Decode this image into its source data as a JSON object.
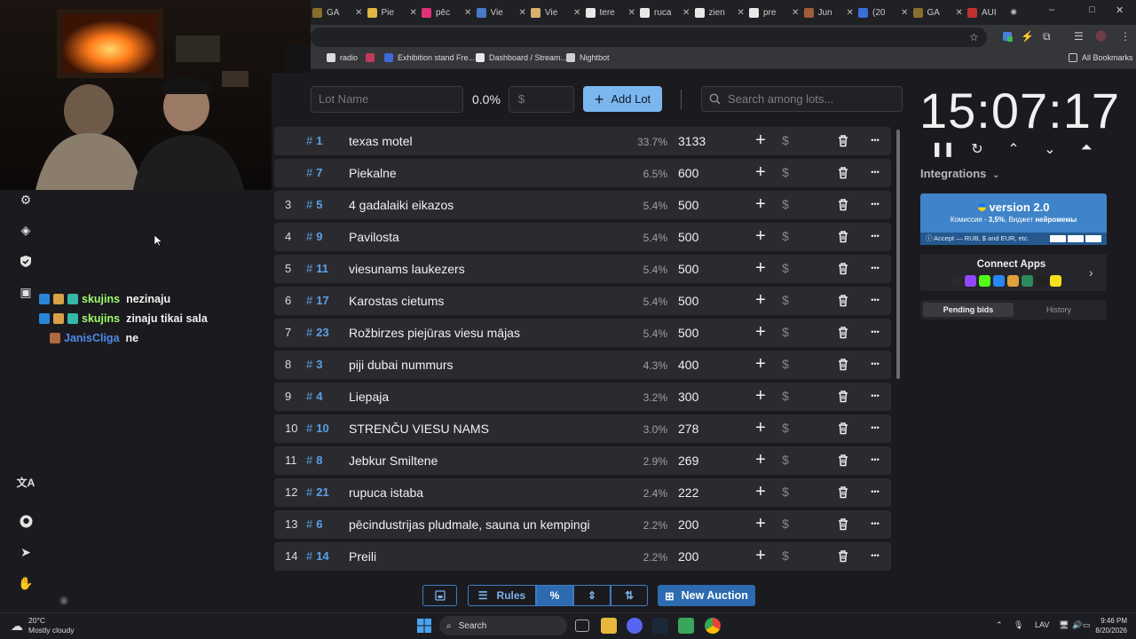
{
  "browser": {
    "tabs": [
      {
        "label": "GA",
        "color": "#8a6d2e"
      },
      {
        "label": "Pie",
        "color": "#e0b640"
      },
      {
        "label": "pēc",
        "color": "#e0307a"
      },
      {
        "label": "Vie",
        "color": "#4a78c8"
      },
      {
        "label": "Vie",
        "color": "#d8b070"
      },
      {
        "label": "tere",
        "color": "#e8e8e8"
      },
      {
        "label": "ruca",
        "color": "#e8e8e8"
      },
      {
        "label": "zien",
        "color": "#e8e8e8"
      },
      {
        "label": "pre",
        "color": "#e8e8e8"
      },
      {
        "label": "Jun",
        "color": "#a05c3a"
      },
      {
        "label": "(20",
        "color": "#3b6fd8"
      },
      {
        "label": "GA",
        "color": "#8a6d2e"
      },
      {
        "label": "AUI",
        "color": "#c03030"
      }
    ],
    "new_tab_symbol": "+",
    "window_controls": {
      "minimize": "–",
      "maximize": "□",
      "close": "✕"
    },
    "bookmarks": [
      {
        "label": "radio",
        "color": "#ddd"
      },
      {
        "label": "",
        "color": "#c23a5a"
      },
      {
        "label": "Exhibition stand Fre...",
        "color": "#3d6bd6"
      },
      {
        "label": "Dashboard / Stream...",
        "color": "#e8e8e8"
      },
      {
        "label": "Nightbot",
        "color": "#cfcfcf"
      }
    ],
    "all_bookmarks": "All Bookmarks"
  },
  "chat": [
    {
      "user": "skujins",
      "message": "nezinaju",
      "color": "#9dfc6a"
    },
    {
      "user": "skujins",
      "message": "zinaju tikai sala",
      "color": "#9dfc6a"
    },
    {
      "user": "JanisCliga",
      "message": "ne",
      "color": "#4f8ae8"
    }
  ],
  "auction": {
    "lot_name_placeholder": "Lot Name",
    "percent": "0.0%",
    "amount_placeholder": "$",
    "add_lot": "Add Lot",
    "search_placeholder": "Search among lots...",
    "lots": [
      {
        "idx": "",
        "num": "1",
        "name": "texas motel",
        "pct": "33.7%",
        "amount": "3133"
      },
      {
        "idx": "",
        "num": "7",
        "name": "Piekalne",
        "pct": "6.5%",
        "amount": "600"
      },
      {
        "idx": "3",
        "num": "5",
        "name": "4 gadalaiki eikazos",
        "pct": "5.4%",
        "amount": "500"
      },
      {
        "idx": "4",
        "num": "9",
        "name": "Pavilosta",
        "pct": "5.4%",
        "amount": "500"
      },
      {
        "idx": "5",
        "num": "11",
        "name": " viesunams laukezers",
        "pct": "5.4%",
        "amount": "500"
      },
      {
        "idx": "6",
        "num": "17",
        "name": "Karostas cietums",
        "pct": "5.4%",
        "amount": "500"
      },
      {
        "idx": "7",
        "num": "23",
        "name": "Rožbirzes piejūras viesu mājas",
        "pct": "5.4%",
        "amount": "500"
      },
      {
        "idx": "8",
        "num": "3",
        "name": "piji dubai nummurs",
        "pct": "4.3%",
        "amount": "400"
      },
      {
        "idx": "9",
        "num": "4",
        "name": "Liepaja",
        "pct": "3.2%",
        "amount": "300"
      },
      {
        "idx": "10",
        "num": "10",
        "name": "STRENČU VIESU NAMS",
        "pct": "3.0%",
        "amount": "278"
      },
      {
        "idx": "11",
        "num": "8",
        "name": "Jebkur Smiltene",
        "pct": "2.9%",
        "amount": "269"
      },
      {
        "idx": "12",
        "num": "21",
        "name": "rupuca istaba",
        "pct": "2.4%",
        "amount": "222"
      },
      {
        "idx": "13",
        "num": "6",
        "name": "pēcindustrijas pludmale, sauna un kempingi",
        "pct": "2.2%",
        "amount": "200"
      },
      {
        "idx": "14",
        "num": "14",
        "name": "Preili",
        "pct": "2.2%",
        "amount": "200"
      }
    ],
    "hash": "#",
    "bottom": {
      "rules": "Rules",
      "percent_symbol": "%",
      "new_auction": "New Auction"
    }
  },
  "right": {
    "timer": "15:07:17",
    "integrations": "Integrations",
    "promo": {
      "version": "version 2.0",
      "commission_prefix": "Комиссия - ",
      "commission_value": "3,5%",
      "widget_prefix": ", Виджет ",
      "widget_value": "нейромемы",
      "accept": "Accept — RUB, $ and EUR, etc."
    },
    "connect_apps": "Connect Apps",
    "pending_bids": "Pending bids",
    "history": "History"
  },
  "taskbar": {
    "temp": "20°C",
    "weather": "Mostly cloudy",
    "search": "Search",
    "lang": "LAV",
    "time": "9:46 PM",
    "date": "8/20/2026"
  },
  "colors": {
    "accent": "#7cb6ef",
    "primary": "#2d6bb1",
    "lot_number": "#5aa0e6"
  }
}
